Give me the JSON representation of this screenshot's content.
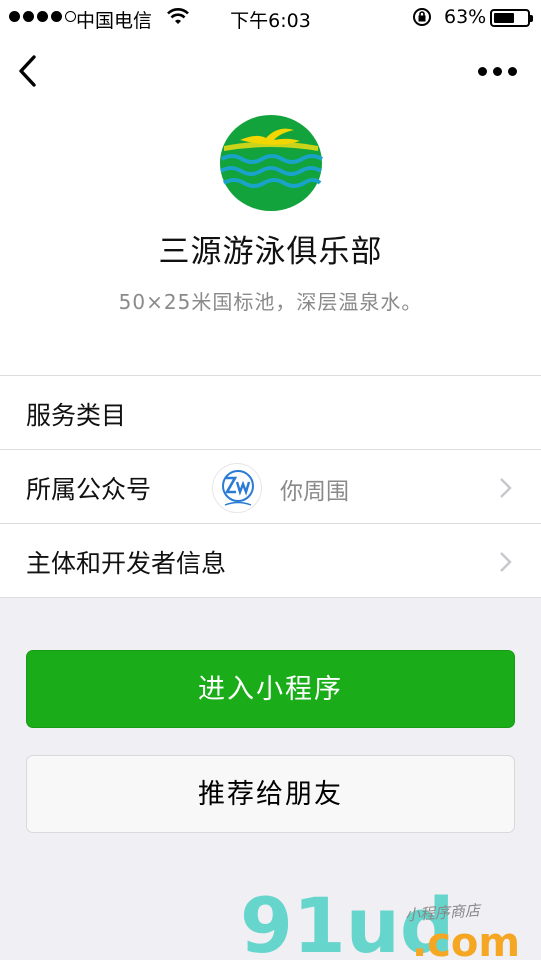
{
  "status_bar": {
    "carrier": "中国电信",
    "time": "下午6:03",
    "battery_percent": "63%",
    "battery_level": 0.63,
    "signal_bars_filled": 4,
    "signal_bars_total": 5
  },
  "nav": {
    "back_icon": "chevron-left-icon",
    "more_icon": "ellipsis-icon"
  },
  "app": {
    "name": "三源游泳俱乐部",
    "description": "50×25米国标池，深层温泉水。",
    "logo_colors": {
      "bg": "#12a33c",
      "band": "#c9d41a",
      "wave": "#1aa3c9",
      "swimmer": "#f1d600"
    }
  },
  "rows": [
    {
      "label": "服务类目"
    },
    {
      "label": "所属公众号",
      "account_name": "你周围"
    },
    {
      "label": "主体和开发者信息"
    }
  ],
  "buttons": {
    "enter": "进入小程序",
    "recommend": "推荐给朋友"
  },
  "watermark": {
    "brand": "91ud",
    "domain": ".com",
    "tagline": "小程序商店"
  },
  "colors": {
    "primary_green": "#1aad19",
    "watermark_teal": "#4fd1c5",
    "watermark_orange": "#f5a623"
  }
}
